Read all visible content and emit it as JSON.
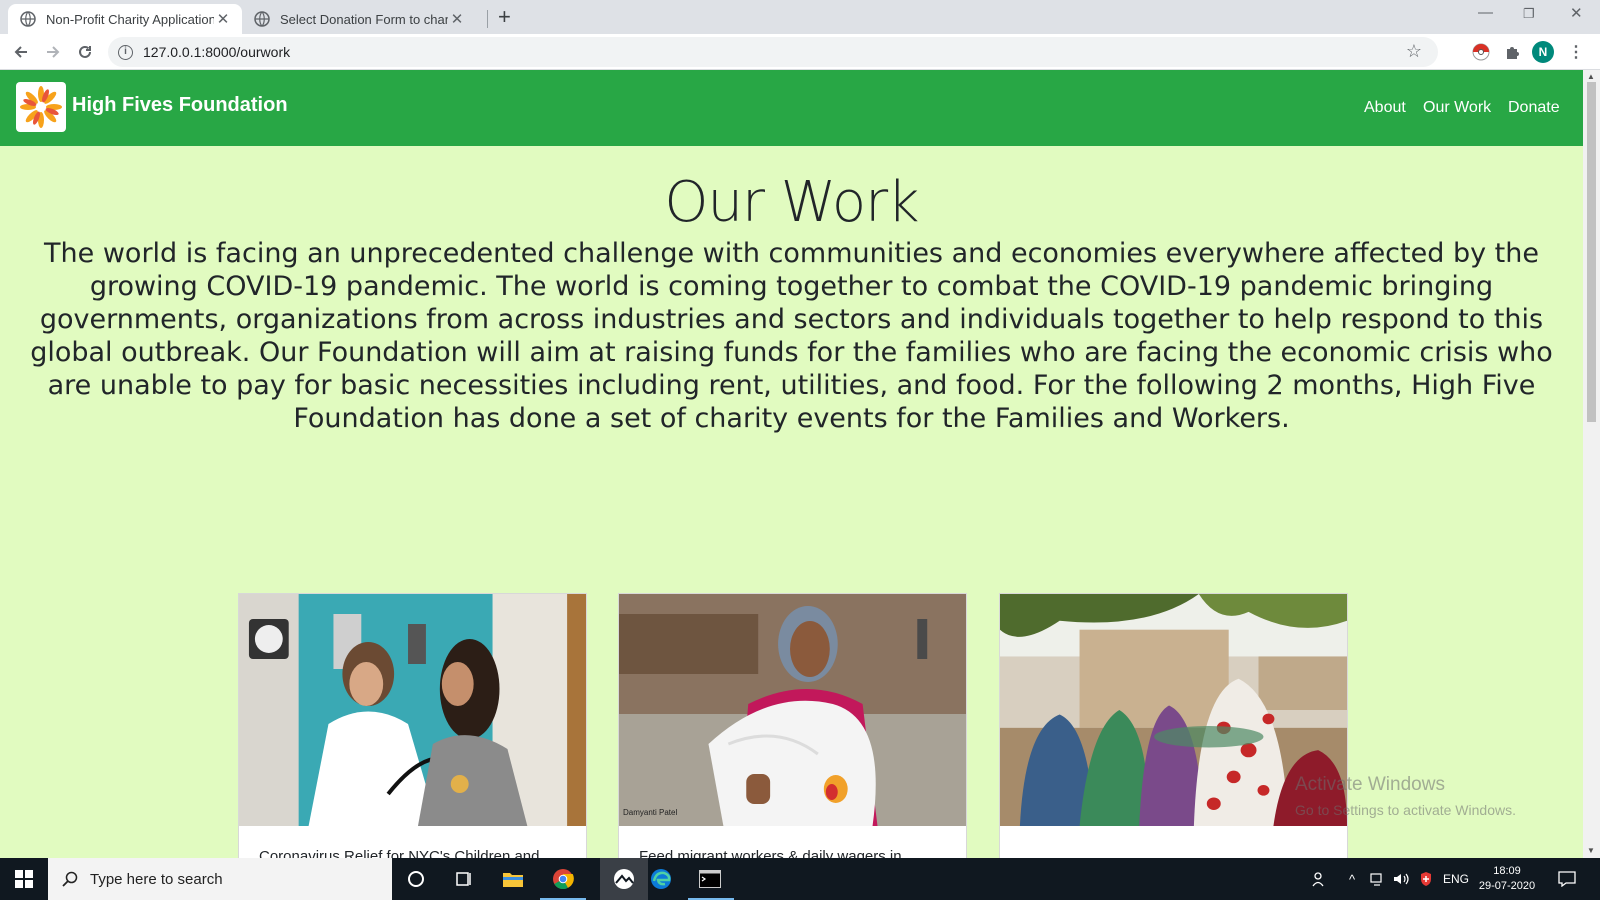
{
  "browser": {
    "tabs": [
      {
        "title": "Non-Profit Charity Application",
        "active": true
      },
      {
        "title": "Select Donation Form to change",
        "active": false
      }
    ],
    "url": "127.0.0.1:8000/ourwork",
    "profile_initial": "N"
  },
  "site": {
    "brand": "High Fives Foundation",
    "nav": [
      "About",
      "Our Work",
      "Donate"
    ],
    "colors": {
      "navbar": "#28a745",
      "background": "#e1fbc0"
    }
  },
  "page": {
    "heading": "Our Work",
    "intro": "The world is facing an unprecedented challenge with communities and economies everywhere affected by the growing COVID-19 pandemic. The world is coming together to combat the COVID-19 pandemic bringing governments, organizations from across industries and sectors and individuals together to help respond to this global outbreak. Our Foundation will aim at raising funds for the families who are facing the economic crisis who are unable to pay for basic necessities including rent, utilities, and food. For the following 2 months, High Five Foundation has done a set of charity events for the Families and Workers.",
    "cards": [
      {
        "title": "Coronavirus Relief for NYC's Children and",
        "image": "doctor-examining-girl photo"
      },
      {
        "title": "Feed migrant workers & daily wagers in",
        "image": "elderly-woman-with-food-bag photo",
        "caption": "Damyanti Patel"
      },
      {
        "title": "",
        "image": "women-gathering-village photo"
      }
    ]
  },
  "watermark": {
    "line1": "Activate Windows",
    "line2": "Go to Settings to activate Windows."
  },
  "taskbar": {
    "search_placeholder": "Type here to search",
    "language": "ENG",
    "time": "18:09",
    "date": "29-07-2020"
  }
}
